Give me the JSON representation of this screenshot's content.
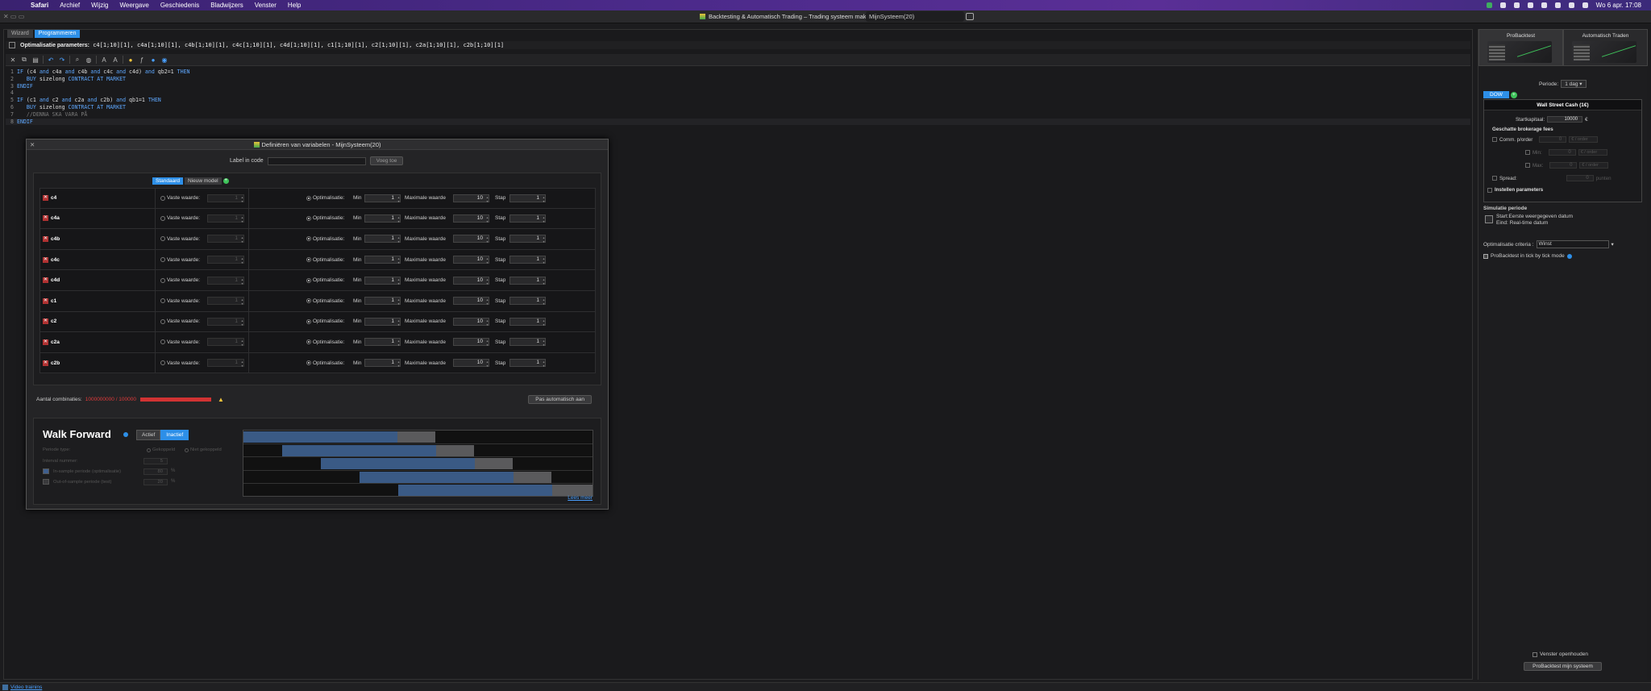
{
  "menubar": {
    "items": [
      "Safari",
      "Archief",
      "Wijzig",
      "Weergave",
      "Geschiedenis",
      "Bladwijzers",
      "Venster",
      "Help"
    ],
    "datetime": "Wo 6 apr.  17:08"
  },
  "window": {
    "title": "Backtesting & Automatisch Trading – Trading systeem maken",
    "tab": "MijnSysteem(20)"
  },
  "editor": {
    "tabs": [
      "Wizard",
      "Programmeren"
    ],
    "params_label": "Optimalisatie parameters:",
    "params_value": "c4[1;10][1], c4a[1;10][1], c4b[1;10][1], c4c[1;10][1], c4d[1;10][1], c1[1;10][1], c2[1;10][1], c2a[1;10][1], c2b[1;10][1]",
    "code": [
      {
        "n": "1",
        "parts": [
          [
            "kw",
            "IF"
          ],
          [
            "t",
            " (c4 "
          ],
          [
            "kw",
            "and"
          ],
          [
            "t",
            " c4a "
          ],
          [
            "kw",
            "and"
          ],
          [
            "t",
            " c4b "
          ],
          [
            "kw",
            "and"
          ],
          [
            "t",
            " c4c "
          ],
          [
            "kw",
            "and"
          ],
          [
            "t",
            " c4d) "
          ],
          [
            "kw",
            "and"
          ],
          [
            "t",
            " qb2=1 "
          ],
          [
            "kw",
            "THEN"
          ]
        ]
      },
      {
        "n": "2",
        "parts": [
          [
            "t",
            "   "
          ],
          [
            "kw",
            "BUY"
          ],
          [
            "t",
            " sizelong "
          ],
          [
            "kw",
            "CONTRACT AT MARKET"
          ]
        ]
      },
      {
        "n": "3",
        "parts": [
          [
            "kw",
            "ENDIF"
          ]
        ]
      },
      {
        "n": "4",
        "parts": [
          [
            "t",
            " "
          ]
        ]
      },
      {
        "n": "5",
        "parts": [
          [
            "kw",
            "IF"
          ],
          [
            "t",
            " (c1 "
          ],
          [
            "kw",
            "and"
          ],
          [
            "t",
            " c2 "
          ],
          [
            "kw",
            "and"
          ],
          [
            "t",
            " c2a "
          ],
          [
            "kw",
            "and"
          ],
          [
            "t",
            " c2b) "
          ],
          [
            "kw",
            "and"
          ],
          [
            "t",
            " qb1=1 "
          ],
          [
            "kw",
            "THEN"
          ]
        ]
      },
      {
        "n": "6",
        "parts": [
          [
            "t",
            "   "
          ],
          [
            "kw",
            "BUY"
          ],
          [
            "t",
            " sizelong "
          ],
          [
            "kw",
            "CONTRACT AT MARKET"
          ]
        ]
      },
      {
        "n": "7",
        "parts": [
          [
            "cm",
            "   //DENNA SKA VARA PÅ"
          ]
        ]
      },
      {
        "n": "8",
        "parts": [
          [
            "kw",
            "ENDIF"
          ]
        ]
      }
    ]
  },
  "dialog": {
    "title": "Definiëren van variabelen - MijnSysteem(20)",
    "label_in_code": "Label in code",
    "add_button": "Voeg toe",
    "model_tabs": [
      "Standaard",
      "Nieuw model"
    ],
    "fixed_label": "Vaste waarde:",
    "opt_label": "Optimalisatie:",
    "min_label": "Min",
    "max_label": "Maximale waarde",
    "step_label": "Stap",
    "variables": [
      {
        "name": "c4",
        "fixed": "1",
        "min": "1",
        "max": "10",
        "step": "1"
      },
      {
        "name": "c4a",
        "fixed": "1",
        "min": "1",
        "max": "10",
        "step": "1"
      },
      {
        "name": "c4b",
        "fixed": "1",
        "min": "1",
        "max": "10",
        "step": "1"
      },
      {
        "name": "c4c",
        "fixed": "1",
        "min": "1",
        "max": "10",
        "step": "1"
      },
      {
        "name": "c4d",
        "fixed": "1",
        "min": "1",
        "max": "10",
        "step": "1"
      },
      {
        "name": "c1",
        "fixed": "1",
        "min": "1",
        "max": "10",
        "step": "1"
      },
      {
        "name": "c2",
        "fixed": "1",
        "min": "1",
        "max": "10",
        "step": "1"
      },
      {
        "name": "c2a",
        "fixed": "1",
        "min": "1",
        "max": "10",
        "step": "1"
      },
      {
        "name": "c2b",
        "fixed": "1",
        "min": "1",
        "max": "10",
        "step": "1"
      }
    ],
    "combinations_label": "Aantal combinaties:",
    "combinations_value": "1000000000 / 100000",
    "auto_button": "Pas automatisch aan",
    "walk_forward": {
      "title": "Walk Forward",
      "toggle": [
        "Actief",
        "Inactief"
      ],
      "periode_type": "Periode type:",
      "opt_gekoppeld": "Gekoppeld",
      "opt_niet_gekoppeld": "Niet gekoppeld",
      "interval_label": "Interval nummer:",
      "interval_value": "5",
      "in_sample_label": "In-sample periode (optimalisatie)",
      "in_sample_value": "80",
      "out_sample_label": "Out-of-sample periode (test)",
      "out_sample_value": "20",
      "pct": "%",
      "more_link": "Lees meer"
    }
  },
  "right_panel": {
    "tabs": [
      "ProBacktest",
      "Automatisch Traden"
    ],
    "periode_label": "Periode:",
    "periode_value": "1 dag",
    "instrument_tab": "DOW",
    "instrument_title": "Wall Street Cash (1€)",
    "startkapitaal_label": "Startkapitaal:",
    "startkapitaal_value": "10000",
    "currency": "€",
    "fees_title": "Geschatte brokerage fees",
    "comm_label": "Comm. p/order",
    "min_label": "Min:",
    "max_label": "Max:",
    "fee_value": "0",
    "per_order": "€ / order",
    "spread_label": "Spread:",
    "spread_unit": "punten",
    "instellen_label": "Instellen parameters",
    "sim_title": "Simulatie periode",
    "sim_start": "Start:Eerste weergegeven datum",
    "sim_end": "Eind: Real-time datum",
    "crit_label": "Optimalisatie criteria :",
    "crit_value": "Winst",
    "tick_label": "ProBacktest in tick by tick mode",
    "open_label": "Venster openhouden",
    "pb_button": "ProBacktest mijn systeem"
  },
  "bottom": {
    "link": "Video trainins"
  }
}
